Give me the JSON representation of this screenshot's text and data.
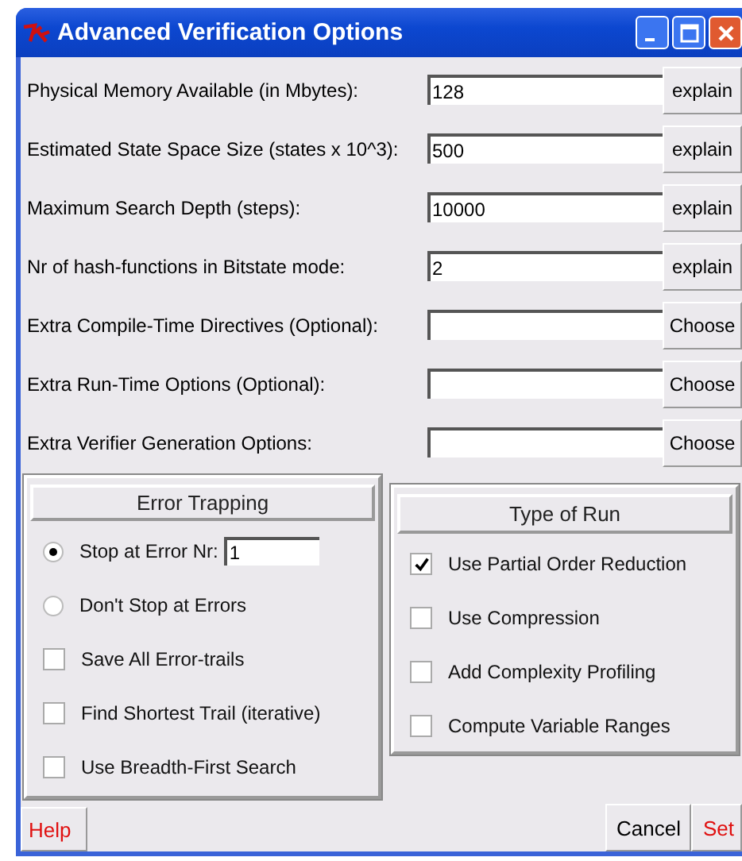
{
  "window": {
    "title": "Advanced Verification Options"
  },
  "fields": [
    {
      "label": "Physical Memory Available (in Mbytes):",
      "value": "128",
      "button": "explain"
    },
    {
      "label": "Estimated State Space Size (states x 10^3):",
      "value": "500",
      "button": "explain"
    },
    {
      "label": "Maximum Search Depth (steps):",
      "value": "10000",
      "button": "explain"
    },
    {
      "label": "Nr of hash-functions in Bitstate mode:",
      "value": "2",
      "button": "explain"
    },
    {
      "label": "Extra Compile-Time Directives (Optional):",
      "button": "Choose"
    },
    {
      "label": "Extra Run-Time Options (Optional):",
      "button": "Choose"
    },
    {
      "label": "Extra Verifier Generation Options:",
      "button": "Choose"
    }
  ],
  "error_trapping": {
    "title": "Error Trapping",
    "options": [
      {
        "kind": "radio",
        "label": "Stop at Error Nr:",
        "selected": true,
        "value": "1"
      },
      {
        "kind": "radio",
        "label": "Don't Stop at Errors",
        "selected": false
      },
      {
        "kind": "checkbox",
        "label": "Save All Error-trails",
        "checked": false
      },
      {
        "kind": "checkbox",
        "label": "Find Shortest Trail (iterative)",
        "checked": false
      },
      {
        "kind": "checkbox",
        "label": "Use Breadth-First Search",
        "checked": false
      }
    ]
  },
  "type_of_run": {
    "title": "Type of Run",
    "options": [
      {
        "label": "Use Partial Order Reduction",
        "checked": true
      },
      {
        "label": "Use Compression",
        "checked": false
      },
      {
        "label": "Add Complexity Profiling",
        "checked": false
      },
      {
        "label": "Compute Variable Ranges",
        "checked": false
      }
    ]
  },
  "buttons": {
    "help": "Help",
    "cancel": "Cancel",
    "set": "Set"
  }
}
